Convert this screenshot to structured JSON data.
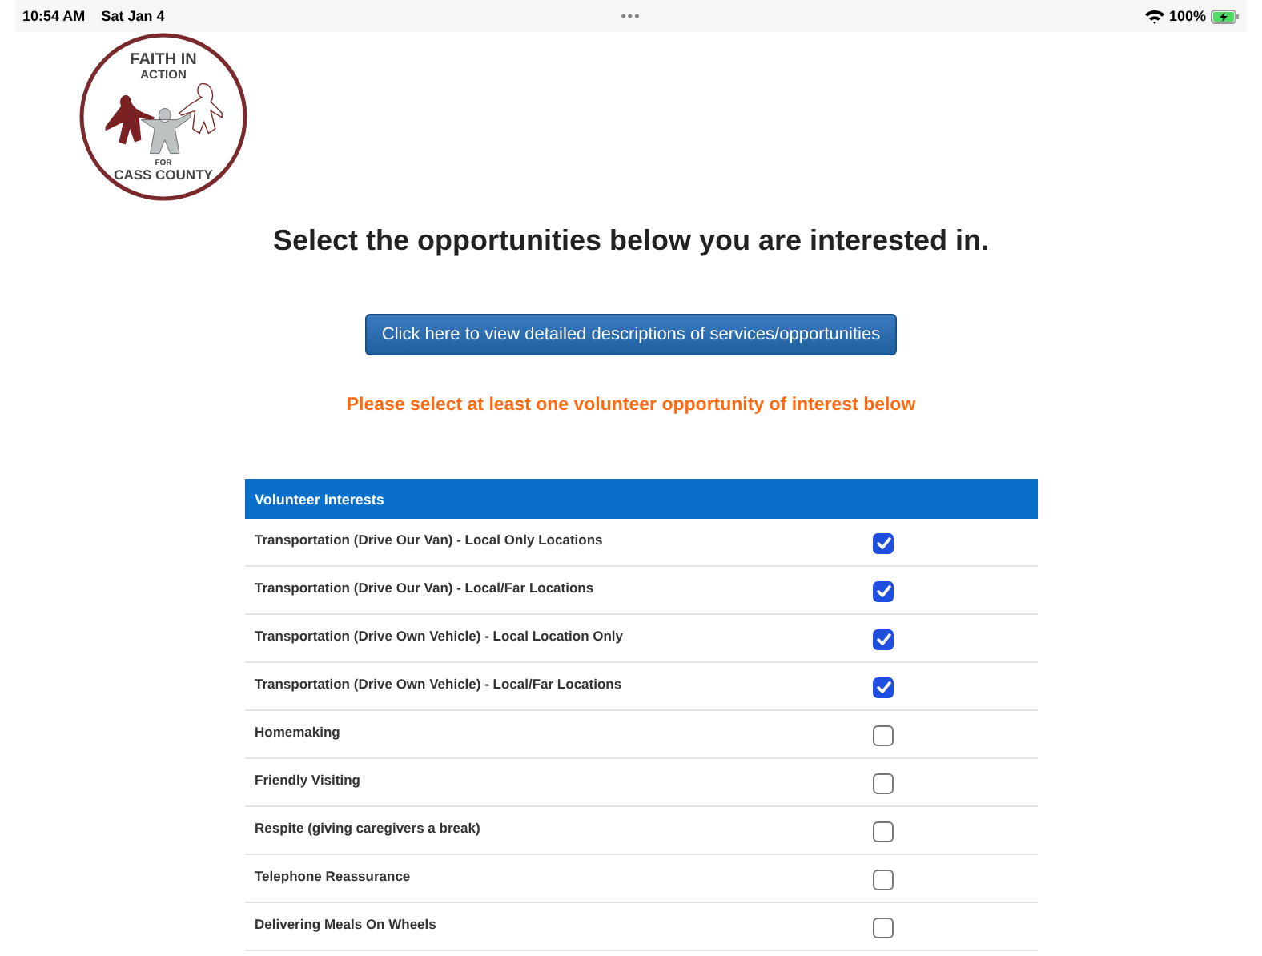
{
  "status_bar": {
    "time": "10:54 AM",
    "date": "Sat Jan 4",
    "dots": "•••",
    "battery": "100%"
  },
  "logo": {
    "top_text": "FAITH IN",
    "middle_text": "ACTION",
    "small_text": "FOR",
    "bottom_text": "CASS COUNTY"
  },
  "title": "Select the opportunities below you are interested in.",
  "descriptions_button": "Click here to view detailed descriptions of services/opportunities",
  "warning": "Please select at least one volunteer opportunity of interest below",
  "table": {
    "header": "Volunteer Interests",
    "rows": [
      {
        "label": "Transportation (Drive Our Van) - Local Only Locations",
        "checked": true
      },
      {
        "label": "Transportation (Drive Our Van) - Local/Far Locations",
        "checked": true
      },
      {
        "label": "Transportation (Drive Own Vehicle) - Local Location Only",
        "checked": true
      },
      {
        "label": "Transportation (Drive Own Vehicle) - Local/Far Locations",
        "checked": true
      },
      {
        "label": "Homemaking",
        "checked": false
      },
      {
        "label": "Friendly Visiting",
        "checked": false
      },
      {
        "label": "Respite (giving caregivers a break)",
        "checked": false
      },
      {
        "label": "Telephone Reassurance",
        "checked": false
      },
      {
        "label": "Delivering Meals On Wheels",
        "checked": false
      }
    ]
  }
}
